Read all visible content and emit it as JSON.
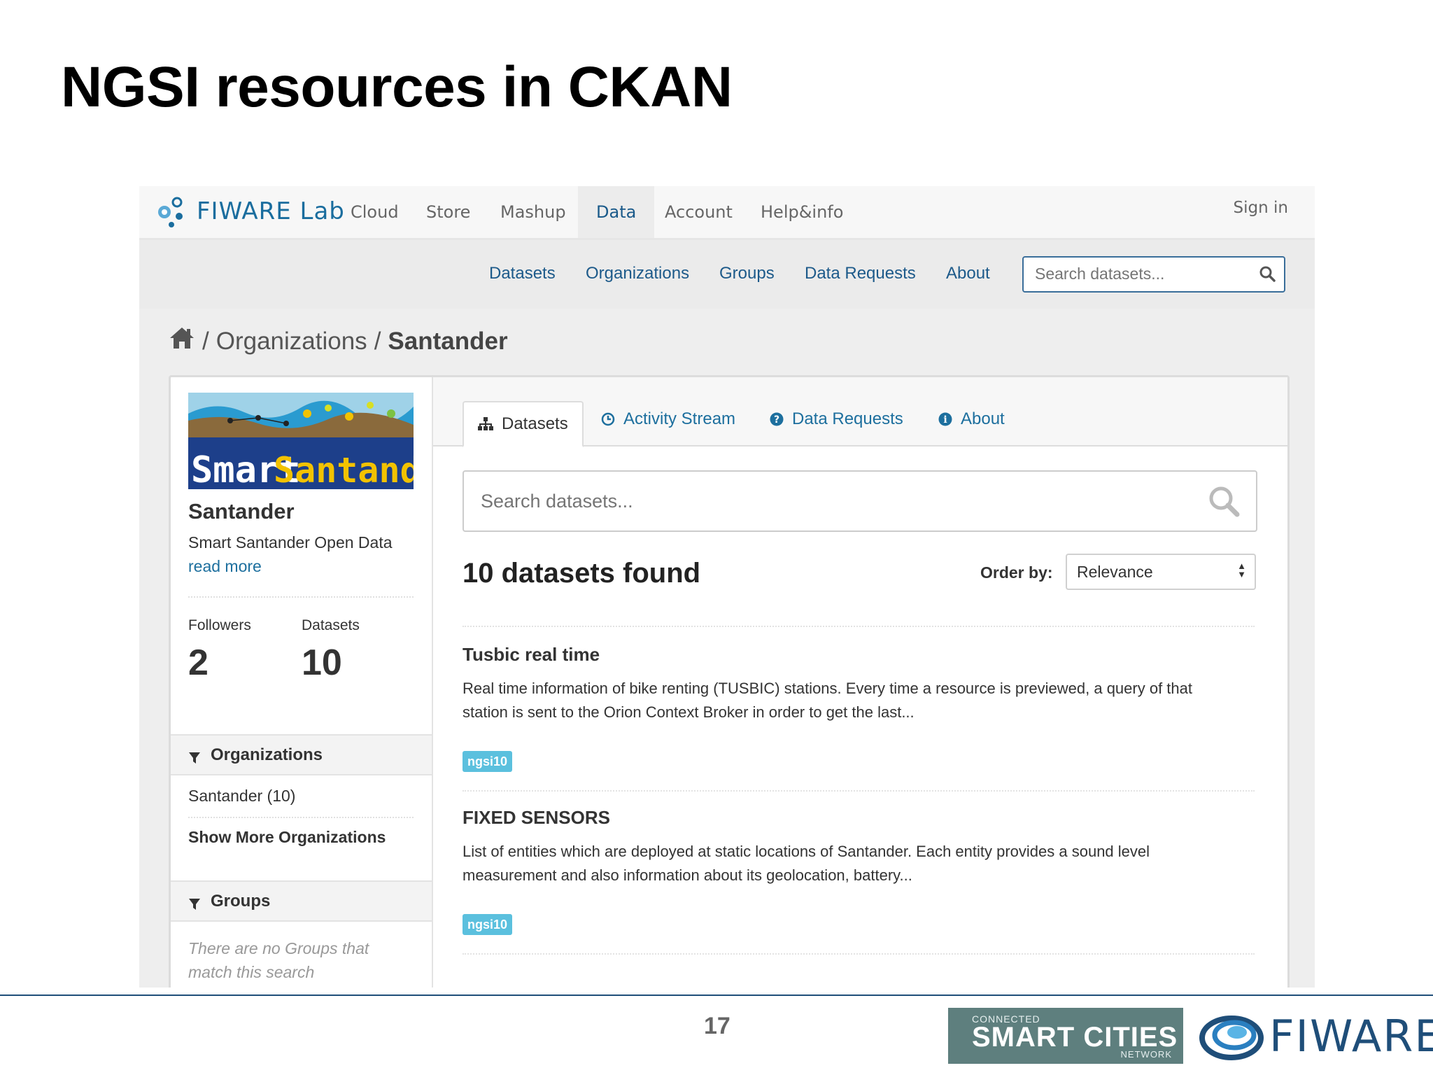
{
  "slide": {
    "title": "NGSI resources in CKAN",
    "page_number": "17",
    "footer": {
      "csc_small": "CONNECTED",
      "csc_big": "SMART CITIES",
      "csc_network": "NETWORK",
      "brand": "FIWARE"
    }
  },
  "topnav": {
    "logo_text": "FIWARE Lab",
    "items": [
      "Cloud",
      "Store",
      "Mashup",
      "Data",
      "Account",
      "Help&info"
    ],
    "active": "Data",
    "sign_in": "Sign in"
  },
  "subnav": {
    "items": [
      "Datasets",
      "Organizations",
      "Groups",
      "Data Requests",
      "About"
    ],
    "search_placeholder": "Search datasets..."
  },
  "breadcrumb": {
    "sep": "/",
    "items": [
      "Organizations",
      "Santander"
    ]
  },
  "sidebar": {
    "org_name": "Santander",
    "org_desc": "Smart Santander Open Data",
    "read_more": "read more",
    "followers_label": "Followers",
    "followers_value": "2",
    "datasets_label": "Datasets",
    "datasets_value": "10",
    "facets": [
      {
        "title": "Organizations",
        "items": [
          "Santander (10)"
        ],
        "more": "Show More Organizations"
      },
      {
        "title": "Groups",
        "empty": "There are no Groups that match this search"
      }
    ]
  },
  "main": {
    "tabs": [
      {
        "label": "Datasets",
        "icon": "sitemap-icon"
      },
      {
        "label": "Activity Stream",
        "icon": "clock-icon"
      },
      {
        "label": "Data Requests",
        "icon": "question-icon"
      },
      {
        "label": "About",
        "icon": "info-icon"
      }
    ],
    "search_placeholder": "Search datasets...",
    "found": "10 datasets found",
    "order_label": "Order by:",
    "order_value": "Relevance",
    "datasets": [
      {
        "title": "Tusbic real time",
        "desc_line1": "Real time information of bike renting (TUSBIC) stations. Every time a resource is previewed, a query of that",
        "desc_line2": "station is sent to the Orion Context Broker in order to get the last...",
        "tag": "ngsi10"
      },
      {
        "title": "FIXED SENSORS",
        "desc_line1": "List of entities which are deployed at static locations of Santander. Each entity provides a sound level",
        "desc_line2": "measurement and also information about its geolocation, battery...",
        "tag": "ngsi10"
      }
    ]
  },
  "org_logo": {
    "text_white": "Smart",
    "text_yellow": "Santander"
  },
  "colors": {
    "link": "#1d6f9e",
    "tag": "#5bc0de",
    "brand_blue": "#1f4e79"
  }
}
